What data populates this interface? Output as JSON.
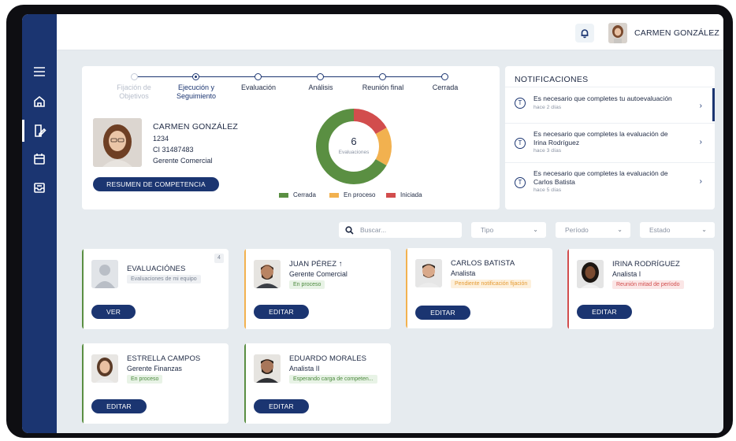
{
  "header": {
    "user_name": "CARMEN GONZÁLEZ",
    "icons": [
      "bell-icon",
      "chevron-down-icon"
    ]
  },
  "sidebar": {
    "items": [
      {
        "icon": "menu-icon"
      },
      {
        "icon": "home-icon"
      },
      {
        "icon": "edit-document-icon",
        "active": true
      },
      {
        "icon": "calendar-icon"
      },
      {
        "icon": "inbox-icon"
      }
    ]
  },
  "stepper": {
    "steps": [
      {
        "label_line1": "Fijación de",
        "label_line2": "Objetivos",
        "state": "done"
      },
      {
        "label_line1": "Ejecución y",
        "label_line2": "Seguimiento",
        "state": "current"
      },
      {
        "label_line1": "Evaluación",
        "label_line2": "",
        "state": "pending"
      },
      {
        "label_line1": "Análisis",
        "label_line2": "",
        "state": "pending"
      },
      {
        "label_line1": "Reunión final",
        "label_line2": "",
        "state": "pending"
      },
      {
        "label_line1": "Cerrada",
        "label_line2": "",
        "state": "pending"
      }
    ]
  },
  "profile": {
    "name": "CARMEN GONZÁLEZ",
    "id": "1234",
    "ci": "CI 31487483",
    "role": "Gerente Comercial",
    "button": "RESUMEN DE COMPETENCIA"
  },
  "evaluations_chart": {
    "total": "6",
    "caption": "Evaluaciones",
    "segments": [
      {
        "name": "Cerrada",
        "value": 4,
        "color": "#5a8f42"
      },
      {
        "name": "En proceso",
        "value": 1,
        "color": "#f2b14f"
      },
      {
        "name": "Iniciada",
        "value": 1,
        "color": "#d24d4d"
      }
    ]
  },
  "notifications": {
    "title": "NOTIFICACIONES",
    "items": [
      {
        "icon_letter": "T",
        "text_line1": "Es necesario que completes tu autoevaluación",
        "text_line2": "",
        "ago": "hace 2 días"
      },
      {
        "icon_letter": "T",
        "text_line1": "Es necesario que completes la evaluación de",
        "text_line2": "Irina Rodríguez",
        "ago": "hace 3 días"
      },
      {
        "icon_letter": "T",
        "text_line1": "Es necesario que completes la evaluación de",
        "text_line2": "Carlos Batista",
        "ago": "hace 5 días"
      }
    ]
  },
  "filters": {
    "search_placeholder": "Buscar...",
    "tipo": "Tipo",
    "periodo": "Período",
    "estado": "Estado"
  },
  "cards": [
    {
      "name": "EVALUACIÓNES",
      "role": "",
      "status": "Evaluaciones de mi equipo",
      "status_style": "grey",
      "button": "VER",
      "accent": "#5a8f42",
      "badge": "4"
    },
    {
      "name": "JUAN PÉREZ ↑",
      "role": "Gerente Comercial",
      "status": "En proceso",
      "status_style": "green",
      "button": "EDITAR",
      "accent": "#f2b14f"
    },
    {
      "name": "CARLOS BATISTA",
      "role": "Analista",
      "status": "Pendiente notificación fijación",
      "status_style": "orange",
      "button": "EDITAR",
      "accent": "#f2b14f"
    },
    {
      "name": "IRINA RODRÍGUEZ",
      "role": "Analista I",
      "status": "Reunión mitad de período",
      "status_style": "red",
      "button": "EDITAR",
      "accent": "#d24d4d"
    },
    {
      "name": "ESTRELLA CAMPOS",
      "role": "Gerente Finanzas",
      "status": "En proceso",
      "status_style": "green",
      "button": "EDITAR",
      "accent": "#5a8f42"
    },
    {
      "name": "EDUARDO MORALES",
      "role": "Analista II",
      "status": "Esperando carga de competen...",
      "status_style": "green",
      "button": "EDITAR",
      "accent": "#5a8f42"
    }
  ]
}
